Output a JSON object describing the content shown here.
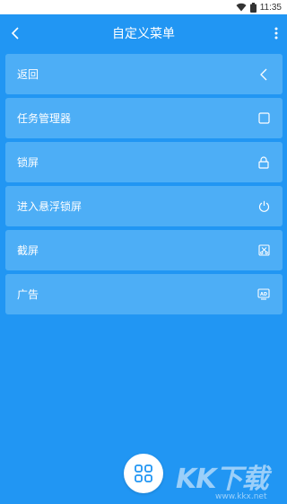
{
  "status_bar": {
    "time": "11:35"
  },
  "header": {
    "title": "自定义菜单"
  },
  "menu": {
    "items": [
      {
        "label": "返回",
        "icon": "chevron-left-icon"
      },
      {
        "label": "任务管理器",
        "icon": "square-icon"
      },
      {
        "label": "锁屏",
        "icon": "lock-icon"
      },
      {
        "label": "进入悬浮锁屏",
        "icon": "power-icon"
      },
      {
        "label": "截屏",
        "icon": "screenshot-icon"
      },
      {
        "label": "广告",
        "icon": "ad-icon"
      }
    ]
  },
  "watermark": {
    "brand": "KK下载",
    "url": "www.kkx.net"
  },
  "colors": {
    "background": "#2196F3",
    "item_background": "#4DAEF6",
    "status_bar": "#ffffff"
  }
}
